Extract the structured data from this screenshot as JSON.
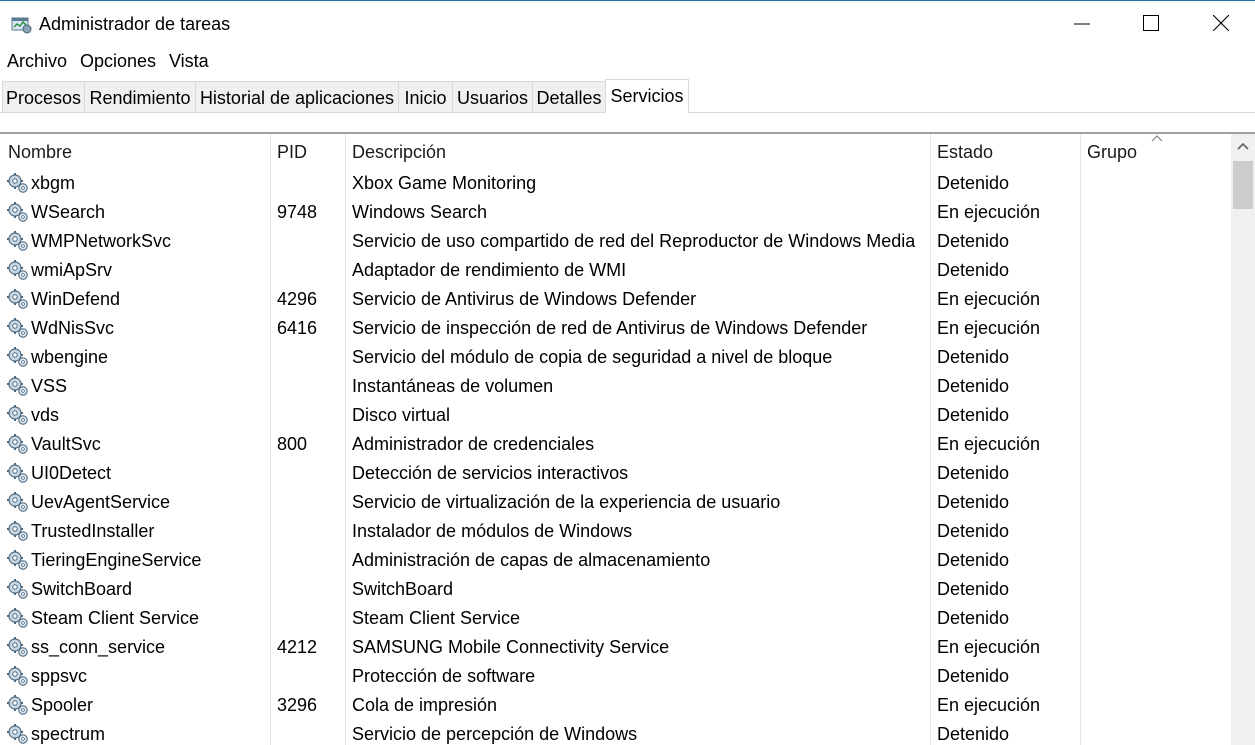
{
  "window": {
    "title": "Administrador de tareas",
    "accent_color": "#1f78b4"
  },
  "menu": [
    "Archivo",
    "Opciones",
    "Vista"
  ],
  "tabs": [
    {
      "label": "Procesos",
      "active": false
    },
    {
      "label": "Rendimiento",
      "active": false
    },
    {
      "label": "Historial de aplicaciones",
      "active": false
    },
    {
      "label": "Inicio",
      "active": false
    },
    {
      "label": "Usuarios",
      "active": false
    },
    {
      "label": "Detalles",
      "active": false
    },
    {
      "label": "Servicios",
      "active": true
    }
  ],
  "columns": {
    "name": "Nombre",
    "pid": "PID",
    "description": "Descripción",
    "status": "Estado",
    "group": "Grupo"
  },
  "sort": {
    "column": "group",
    "direction": "ascending"
  },
  "rows": [
    {
      "name": "xbgm",
      "pid": "",
      "description": "Xbox Game Monitoring",
      "status": "Detenido",
      "group": ""
    },
    {
      "name": "WSearch",
      "pid": "9748",
      "description": "Windows Search",
      "status": "En ejecución",
      "group": ""
    },
    {
      "name": "WMPNetworkSvc",
      "pid": "",
      "description": "Servicio de uso compartido de red del Reproductor de Windows Media",
      "status": "Detenido",
      "group": ""
    },
    {
      "name": "wmiApSrv",
      "pid": "",
      "description": "Adaptador de rendimiento de WMI",
      "status": "Detenido",
      "group": ""
    },
    {
      "name": "WinDefend",
      "pid": "4296",
      "description": "Servicio de Antivirus de Windows Defender",
      "status": "En ejecución",
      "group": ""
    },
    {
      "name": "WdNisSvc",
      "pid": "6416",
      "description": "Servicio de inspección de red de Antivirus de Windows Defender",
      "status": "En ejecución",
      "group": ""
    },
    {
      "name": "wbengine",
      "pid": "",
      "description": "Servicio del módulo de copia de seguridad a nivel de bloque",
      "status": "Detenido",
      "group": ""
    },
    {
      "name": "VSS",
      "pid": "",
      "description": "Instantáneas de volumen",
      "status": "Detenido",
      "group": ""
    },
    {
      "name": "vds",
      "pid": "",
      "description": "Disco virtual",
      "status": "Detenido",
      "group": ""
    },
    {
      "name": "VaultSvc",
      "pid": "800",
      "description": "Administrador de credenciales",
      "status": "En ejecución",
      "group": ""
    },
    {
      "name": "UI0Detect",
      "pid": "",
      "description": "Detección de servicios interactivos",
      "status": "Detenido",
      "group": ""
    },
    {
      "name": "UevAgentService",
      "pid": "",
      "description": "Servicio de virtualización de la experiencia de usuario",
      "status": "Detenido",
      "group": ""
    },
    {
      "name": "TrustedInstaller",
      "pid": "",
      "description": "Instalador de módulos de Windows",
      "status": "Detenido",
      "group": ""
    },
    {
      "name": "TieringEngineService",
      "pid": "",
      "description": "Administración de capas de almacenamiento",
      "status": "Detenido",
      "group": ""
    },
    {
      "name": "SwitchBoard",
      "pid": "",
      "description": "SwitchBoard",
      "status": "Detenido",
      "group": ""
    },
    {
      "name": "Steam Client Service",
      "pid": "",
      "description": "Steam Client Service",
      "status": "Detenido",
      "group": ""
    },
    {
      "name": "ss_conn_service",
      "pid": "4212",
      "description": "SAMSUNG Mobile Connectivity Service",
      "status": "En ejecución",
      "group": ""
    },
    {
      "name": "sppsvc",
      "pid": "",
      "description": "Protección de software",
      "status": "Detenido",
      "group": ""
    },
    {
      "name": "Spooler",
      "pid": "3296",
      "description": "Cola de impresión",
      "status": "En ejecución",
      "group": ""
    },
    {
      "name": "spectrum",
      "pid": "",
      "description": "Servicio de percepción de Windows",
      "status": "Detenido",
      "group": ""
    }
  ],
  "icons": {
    "app": "task-manager-icon",
    "service": "service-gear-icon",
    "minimize": "minimize-icon",
    "maximize": "maximize-icon",
    "close": "close-icon",
    "sort": "sort-ascending-icon",
    "scroll_up": "chevron-up-icon"
  }
}
